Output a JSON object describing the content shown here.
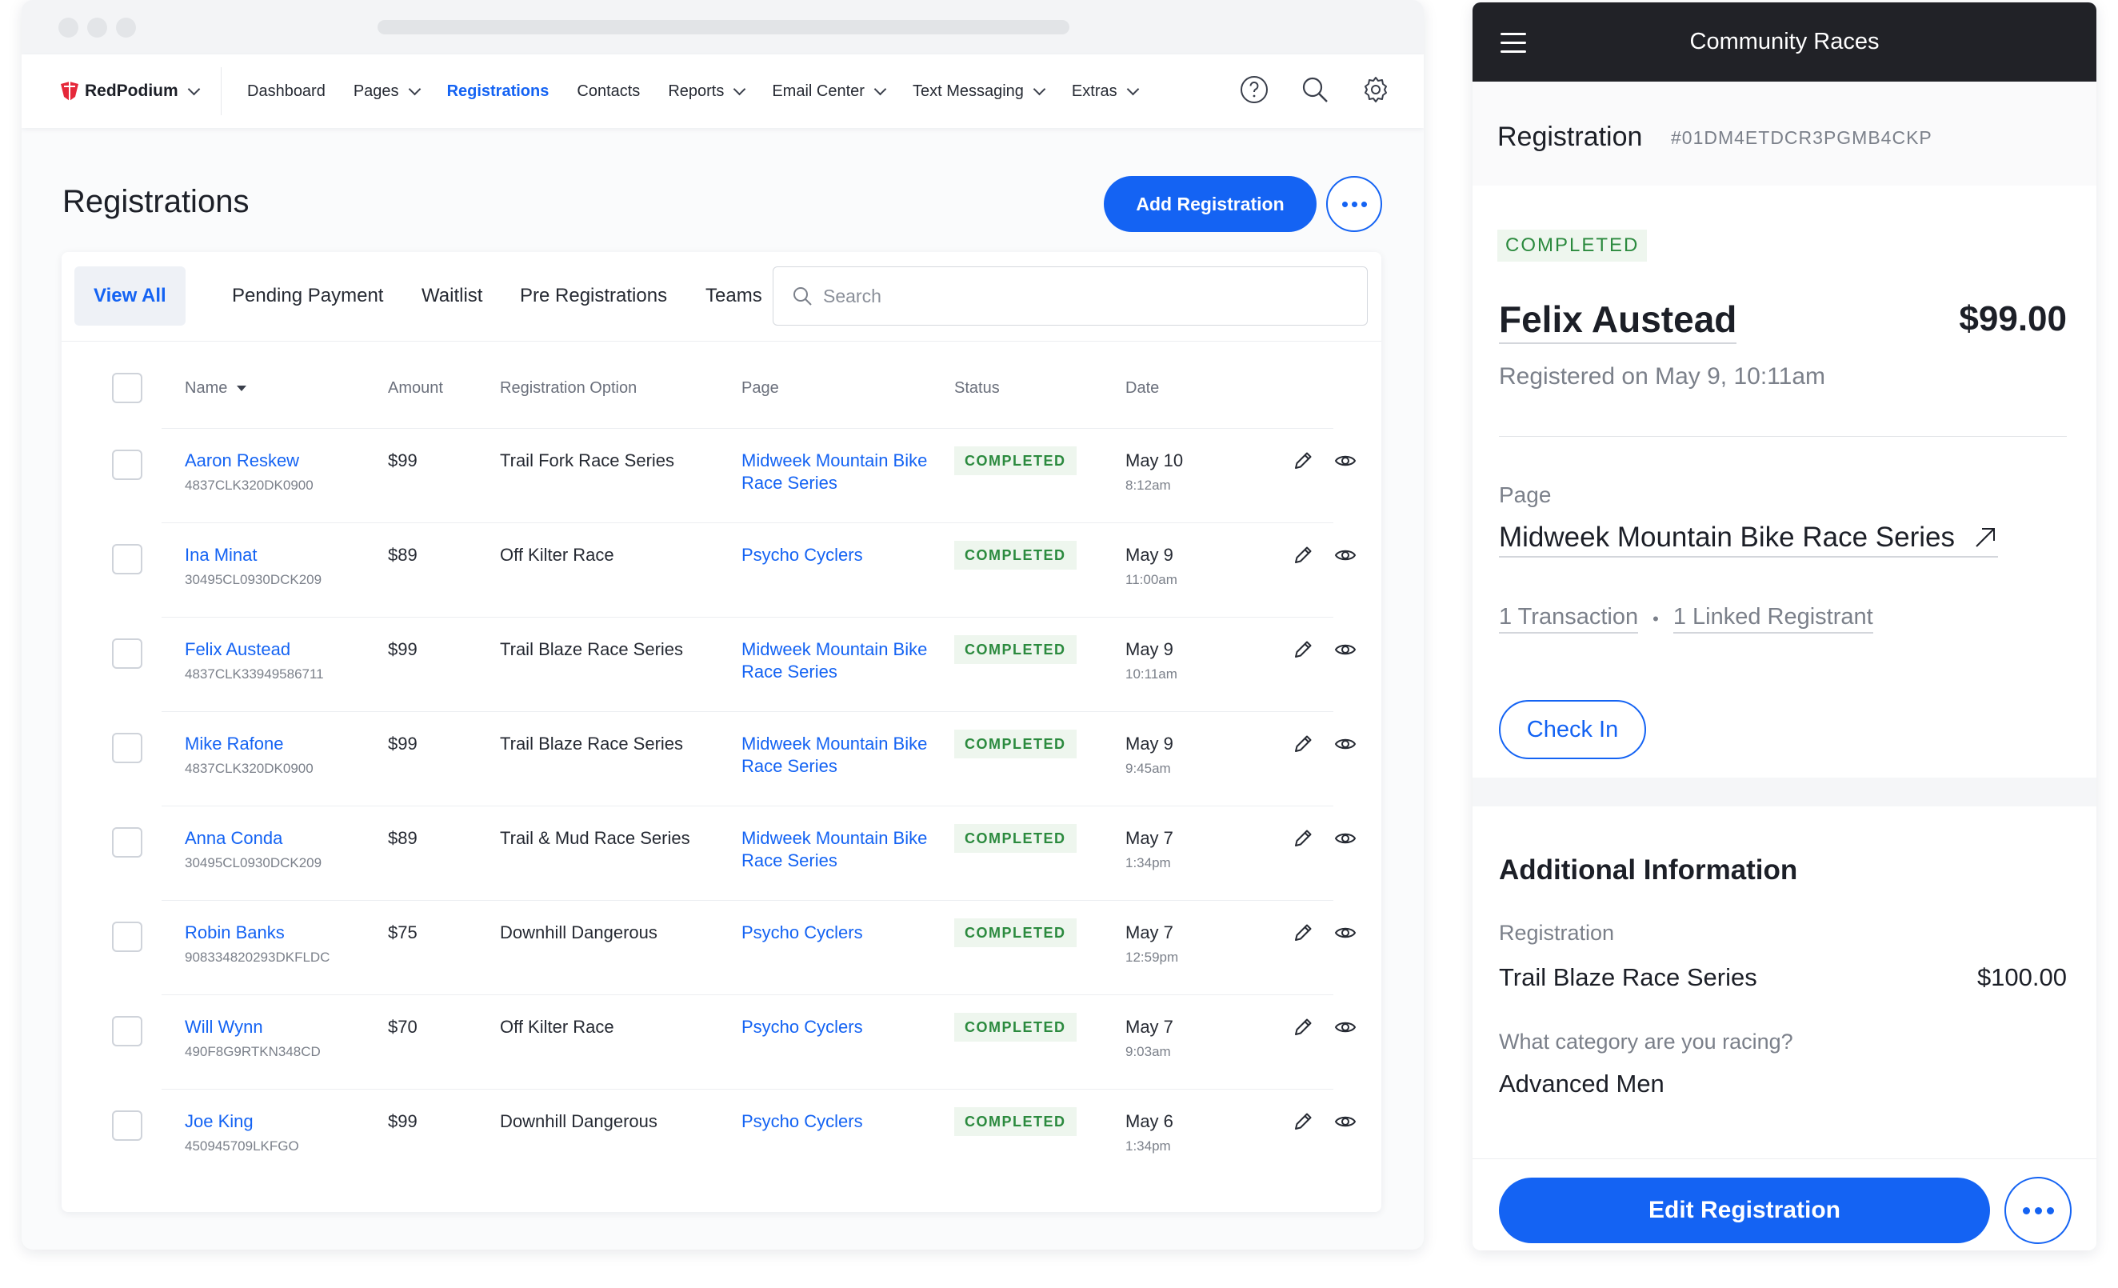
{
  "nav": {
    "brand": "RedPodium",
    "links": [
      "Dashboard",
      "Pages",
      "Registrations",
      "Contacts",
      "Reports",
      "Email Center",
      "Text Messaging",
      "Extras"
    ]
  },
  "main": {
    "title": "Registrations",
    "add_button": "Add Registration",
    "tabs": [
      "View All",
      "Pending Payment",
      "Waitlist",
      "Pre Registrations",
      "Teams"
    ],
    "search_placeholder": "Search",
    "columns": {
      "name": "Name",
      "amount": "Amount",
      "option": "Registration Option",
      "page": "Page",
      "status": "Status",
      "date": "Date"
    },
    "rows": [
      {
        "name": "Aaron Reskew",
        "code": "4837CLK320DK0900",
        "amount": "$99",
        "option": "Trail Fork Race Series",
        "page": "Midweek Mountain Bike Race Series",
        "status": "COMPLETED",
        "date": "May 10",
        "time": "8:12am"
      },
      {
        "name": "Ina Minat",
        "code": "30495CL0930DCK209",
        "amount": "$89",
        "option": "Off Kilter Race",
        "page": "Psycho Cyclers",
        "status": "COMPLETED",
        "date": "May 9",
        "time": "11:00am"
      },
      {
        "name": "Felix Austead",
        "code": "4837CLK33949586711",
        "amount": "$99",
        "option": "Trail Blaze Race Series",
        "page": "Midweek Mountain Bike Race Series",
        "status": "COMPLETED",
        "date": "May 9",
        "time": "10:11am"
      },
      {
        "name": "Mike Rafone",
        "code": "4837CLK320DK0900",
        "amount": "$99",
        "option": "Trail Blaze Race Series",
        "page": "Midweek Mountain Bike Race Series",
        "status": "COMPLETED",
        "date": "May 9",
        "time": "9:45am"
      },
      {
        "name": "Anna Conda",
        "code": "30495CL0930DCK209",
        "amount": "$89",
        "option": "Trail & Mud Race Series",
        "page": "Midweek Mountain Bike Race Series",
        "status": "COMPLETED",
        "date": "May 7",
        "time": "1:34pm"
      },
      {
        "name": "Robin Banks",
        "code": "908334820293DKFLDC",
        "amount": "$75",
        "option": "Downhill Dangerous",
        "page": "Psycho Cyclers",
        "status": "COMPLETED",
        "date": "May 7",
        "time": "12:59pm"
      },
      {
        "name": "Will Wynn",
        "code": "490F8G9RTKN348CD",
        "amount": "$70",
        "option": "Off Kilter Race",
        "page": "Psycho Cyclers",
        "status": "COMPLETED",
        "date": "May 7",
        "time": "9:03am"
      },
      {
        "name": "Joe King",
        "code": "450945709LKFGO",
        "amount": "$99",
        "option": "Downhill Dangerous",
        "page": "Psycho Cyclers",
        "status": "COMPLETED",
        "date": "May 6",
        "time": "1:34pm"
      }
    ]
  },
  "panel": {
    "title": "Community Races",
    "heading": "Registration",
    "reg_code": "#01DM4ETDCR3PGMB4CKP",
    "status": "COMPLETED",
    "person": "Felix Austead",
    "total": "$99.00",
    "registered_on": "Registered on May 9, 10:11am",
    "page_label": "Page",
    "page_value": "Midweek Mountain Bike Race Series",
    "transactions": "1 Transaction",
    "linked": "1 Linked Registrant",
    "check_in": "Check In",
    "additional_heading": "Additional Information",
    "reg_label": "Registration",
    "reg_option": "Trail Blaze Race Series",
    "reg_price": "$100.00",
    "question": "What category are you racing?",
    "answer": "Advanced Men",
    "edit_button": "Edit Registration"
  },
  "colors": {
    "accent": "#1463f3",
    "success": "#2b8a3e",
    "success_bg": "#eef6ee",
    "dark_header": "#212227"
  }
}
